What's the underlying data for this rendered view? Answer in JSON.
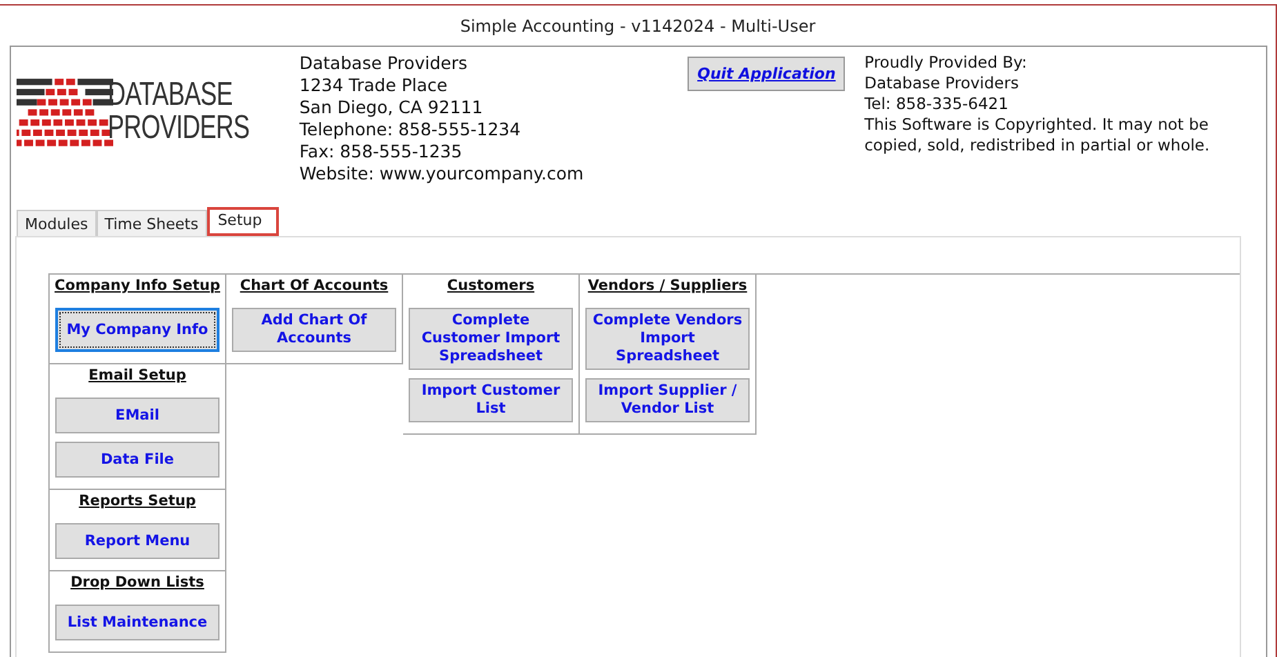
{
  "window": {
    "title": "Simple Accounting - v1142024 - Multi-User"
  },
  "logo": {
    "lines": [
      "DATABASE",
      "PROVIDERS"
    ]
  },
  "company": {
    "lines": [
      "Database Providers",
      "1234 Trade Place",
      "San Diego, CA  92111",
      "Telephone: 858-555-1234",
      "Fax: 858-555-1235",
      "Website: www.yourcompany.com"
    ]
  },
  "quit_button": {
    "label": "Quit Application"
  },
  "provider": {
    "lines": [
      "Proudly Provided By:",
      "Database Providers",
      "Tel: 858-335-6421"
    ],
    "notice": "This Software is Copyrighted. It may not be copied, sold, redistribed in partial or whole."
  },
  "tabs": [
    {
      "label": "Modules",
      "selected": false
    },
    {
      "label": "Time Sheets",
      "selected": false
    },
    {
      "label": "Setup",
      "selected": true
    }
  ],
  "columns": [
    [
      {
        "heading": "Company Info Setup",
        "buttons": [
          {
            "label": "My Company Info",
            "focused": true
          }
        ]
      },
      {
        "heading": "Email Setup",
        "buttons": [
          {
            "label": "EMail",
            "focused": false
          },
          {
            "label": "Data File",
            "focused": false
          }
        ]
      },
      {
        "heading": "Reports Setup",
        "buttons": [
          {
            "label": "Report Menu",
            "focused": false
          }
        ]
      },
      {
        "heading": "Drop Down Lists",
        "buttons": [
          {
            "label": "List Maintenance",
            "focused": false
          }
        ]
      }
    ],
    [
      {
        "heading": "Chart Of Accounts",
        "buttons": [
          {
            "label": "Add Chart Of Accounts",
            "focused": false
          }
        ]
      }
    ],
    [
      {
        "heading": "Customers",
        "buttons": [
          {
            "label": "Complete Customer Import Spreadsheet",
            "focused": false
          },
          {
            "label": "Import Customer List",
            "focused": false
          }
        ]
      }
    ],
    [
      {
        "heading": "Vendors / Suppliers",
        "buttons": [
          {
            "label": "Complete Vendors Import Spreadsheet",
            "focused": false
          },
          {
            "label": "Import Supplier / Vendor List",
            "focused": false
          }
        ]
      }
    ]
  ]
}
